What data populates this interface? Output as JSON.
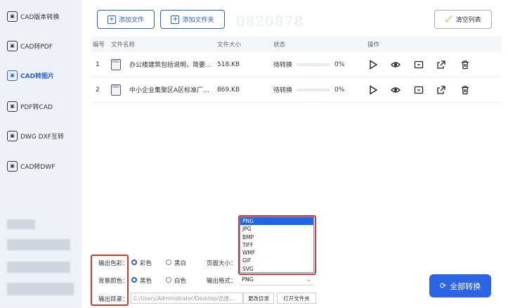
{
  "sidebar": {
    "items": [
      {
        "label": "CAD版本转换",
        "icon": "cad-version-icon"
      },
      {
        "label": "CAD转PDF",
        "icon": "cad-pdf-icon"
      },
      {
        "label": "CAD转图片",
        "icon": "cad-image-icon",
        "active": true
      },
      {
        "label": "PDF转CAD",
        "icon": "pdf-cad-icon"
      },
      {
        "label": "DWG DXF互转",
        "icon": "dwg-dxf-icon"
      },
      {
        "label": "CAD转DWF",
        "icon": "cad-dwf-icon"
      }
    ]
  },
  "toolbar": {
    "add_file": "添加文件",
    "add_folder": "添加文件夹",
    "clear_list": "清空列表",
    "watermark": "0820878"
  },
  "table": {
    "headers": {
      "index": "编号",
      "name": "文件名称",
      "size": "文件大小",
      "status": "状态",
      "actions": "操作"
    },
    "rows": [
      {
        "index": "1",
        "name": "办公楼建筑包括说明，简要...",
        "size": "518.KB",
        "status": "待转换",
        "progress": "0%"
      },
      {
        "index": "2",
        "name": "中小企业集聚区A区标准厂...",
        "size": "869.KB",
        "status": "待转换",
        "progress": "0%"
      }
    ]
  },
  "settings": {
    "output_color_label": "输出色彩：",
    "color_options": [
      "彩色",
      "黑白"
    ],
    "bg_color_label": "背景颜色：",
    "bg_options": [
      "黑色",
      "白色"
    ],
    "page_size_label": "页面大小：",
    "output_format_label": "输出格式：",
    "output_format_value": "PNG",
    "output_dir_label": "输出目录：",
    "output_dir_value": "C:/Users/Administrator/Desktop/迅捷...",
    "change_dir": "更改目录",
    "open_folder": "打开文件夹"
  },
  "dropdown": {
    "options": [
      "PNG",
      "JPG",
      "BMP",
      "TIFF",
      "WMF",
      "GIF",
      "SVG"
    ],
    "selected": "PNG"
  },
  "convert_all": "全部转换",
  "colors": {
    "accent": "#2b5fd9",
    "highlight": "#d9362b"
  }
}
